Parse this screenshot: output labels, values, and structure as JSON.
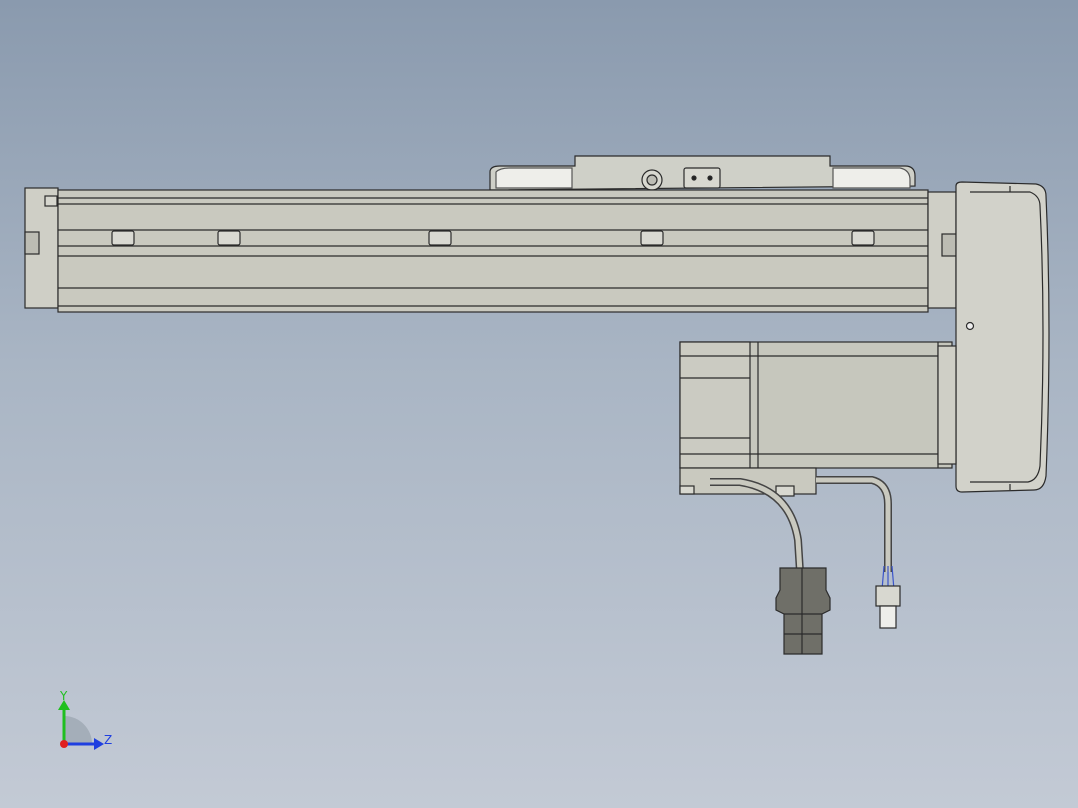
{
  "viewport": {
    "background_top": "#8a9aae",
    "background_bottom": "#c3cad5"
  },
  "model": {
    "body_color": "#c9c9bf",
    "edge_color": "#2b2b2b",
    "carriage_color": "#cfd0c8",
    "motor_color": "#c6c7bd",
    "connector_color": "#6f6f68"
  },
  "triad": {
    "y_label": "Y",
    "z_label": "Z",
    "y_color": "#1fbf1f",
    "z_color": "#1f3fe0",
    "x_color": "#e02020"
  }
}
